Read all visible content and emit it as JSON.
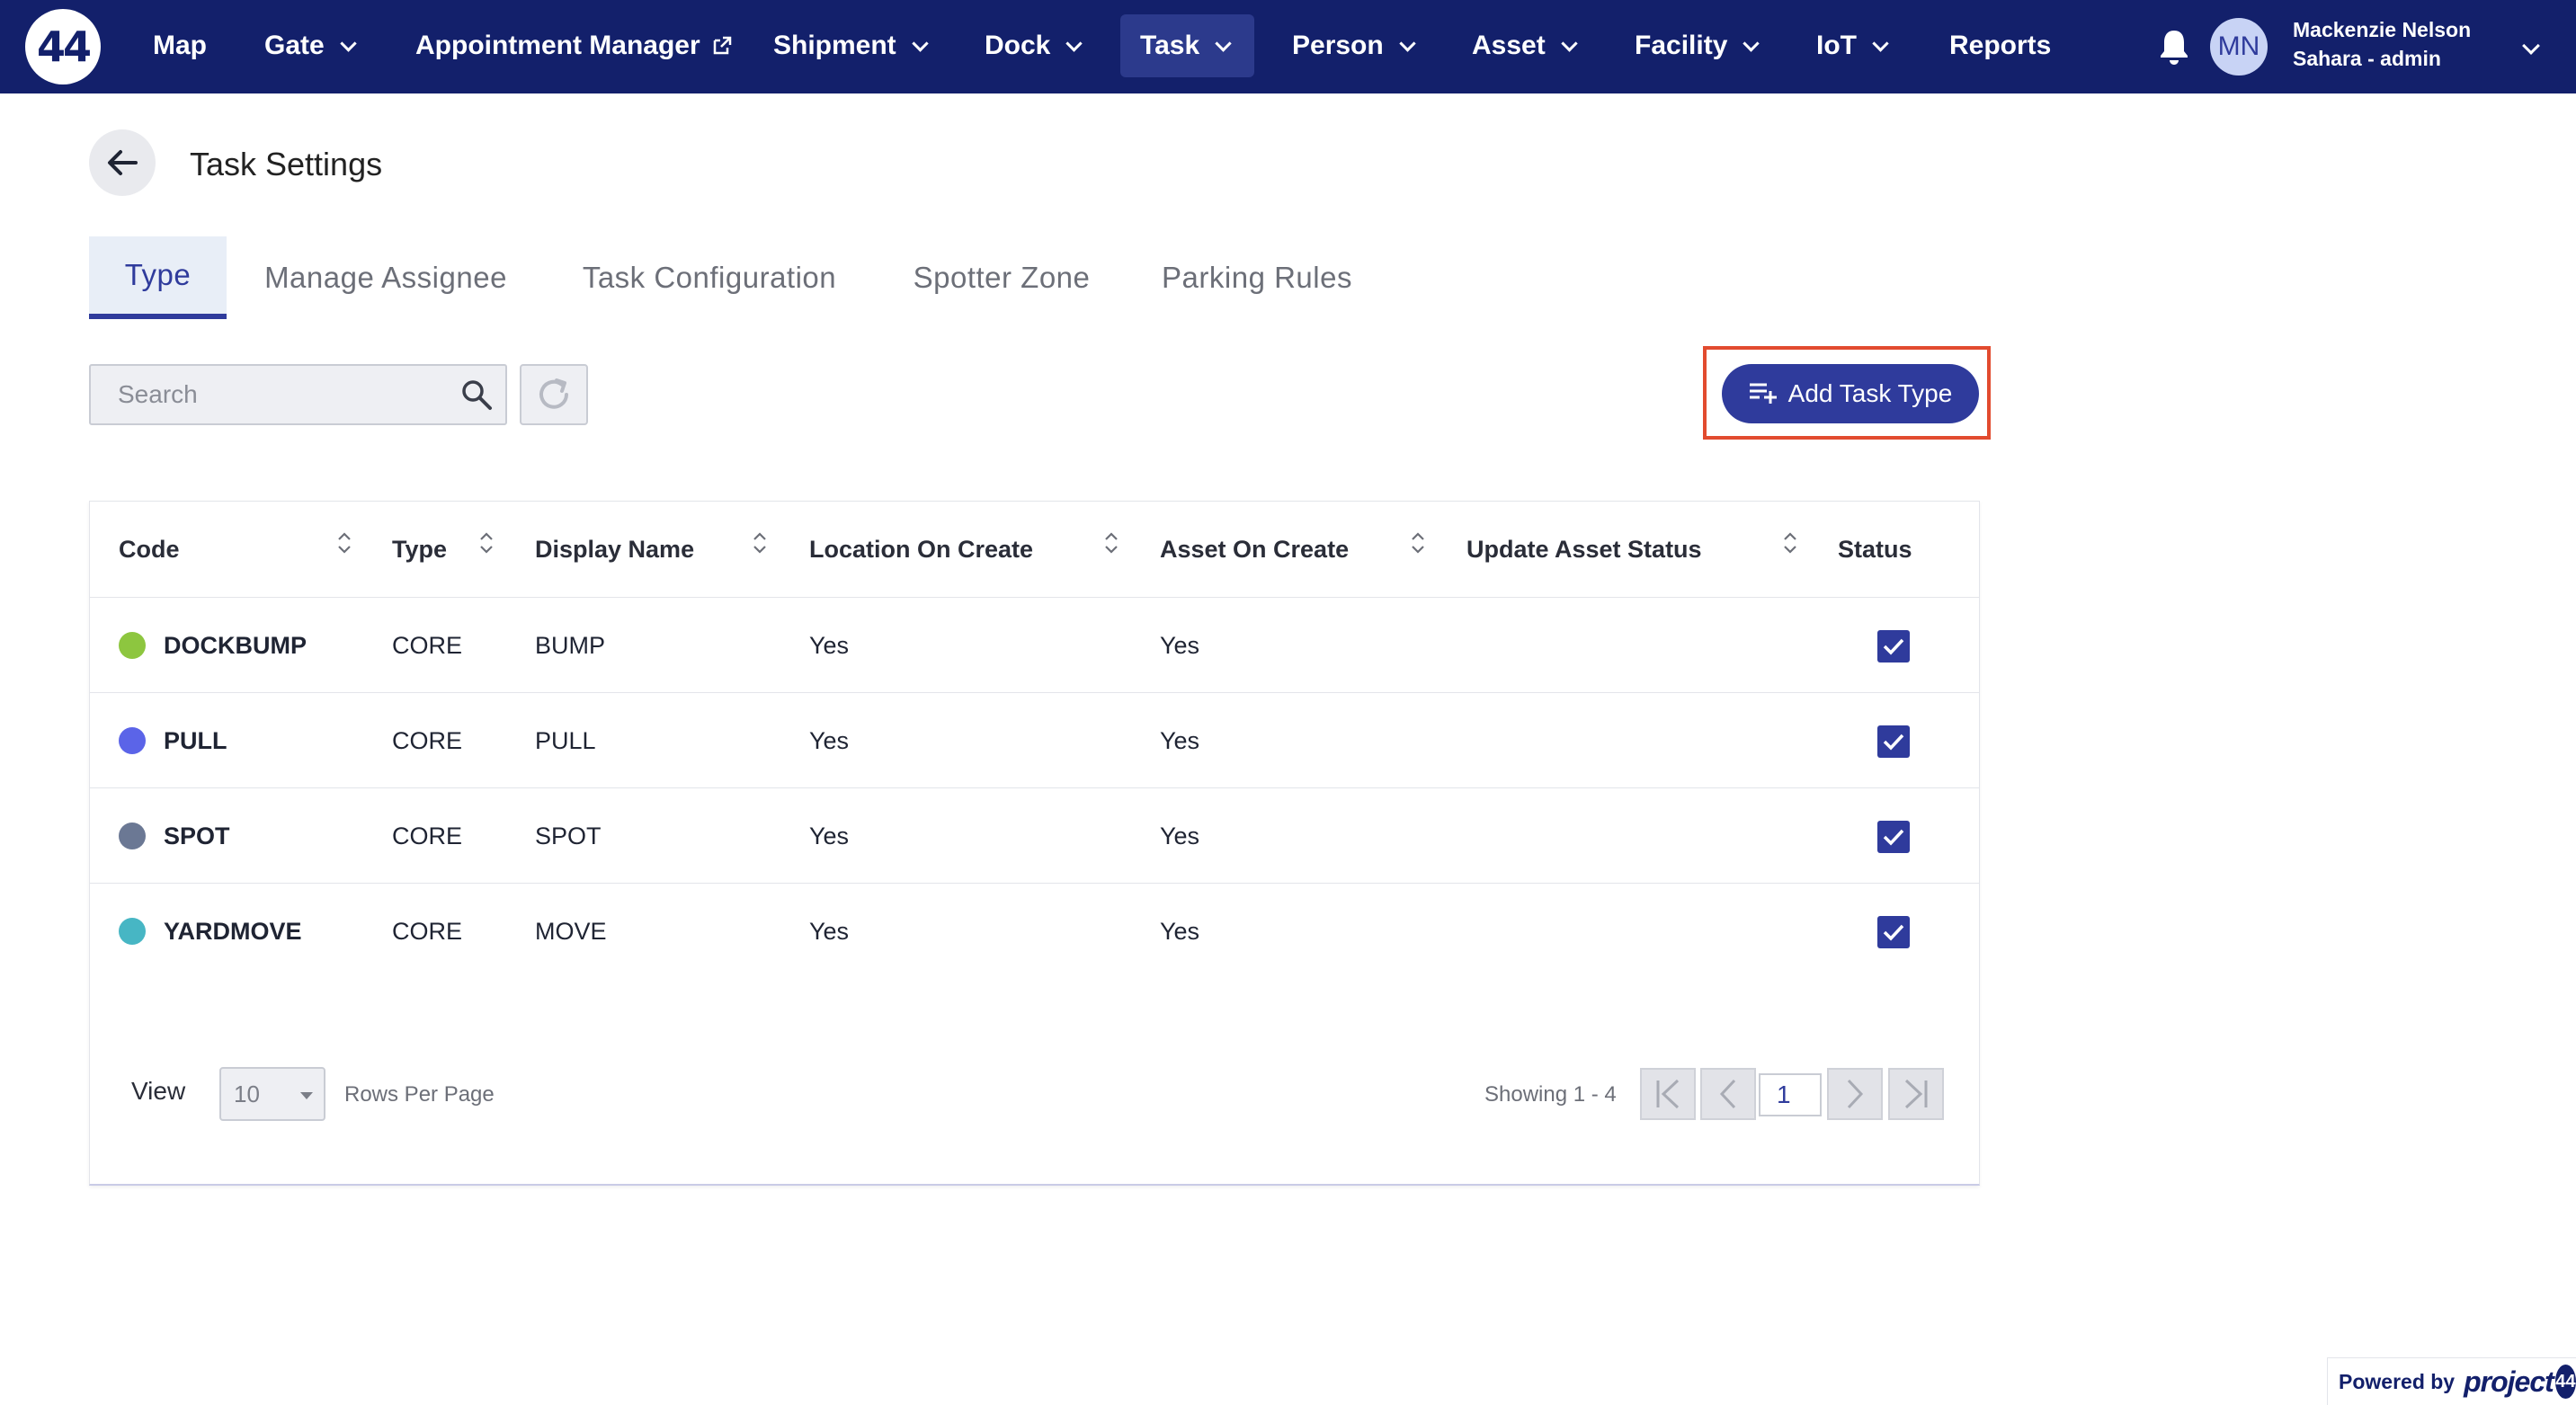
{
  "nav": {
    "logo": "44",
    "items": [
      {
        "label": "Map",
        "dropdown": false
      },
      {
        "label": "Gate",
        "dropdown": true
      },
      {
        "label": "Appointment Manager",
        "dropdown": false,
        "external": true
      },
      {
        "label": "Shipment",
        "dropdown": true
      },
      {
        "label": "Dock",
        "dropdown": true
      },
      {
        "label": "Task",
        "dropdown": true,
        "active": true
      },
      {
        "label": "Person",
        "dropdown": true
      },
      {
        "label": "Asset",
        "dropdown": true
      },
      {
        "label": "Facility",
        "dropdown": true
      },
      {
        "label": "IoT",
        "dropdown": true
      },
      {
        "label": "Reports",
        "dropdown": false
      }
    ],
    "user": {
      "initials": "MN",
      "name": "Mackenzie Nelson",
      "role": "Sahara - admin"
    }
  },
  "header": {
    "title": "Task Settings",
    "back_icon": "arrow-left-icon"
  },
  "tabs": [
    {
      "label": "Type",
      "active": true
    },
    {
      "label": "Manage Assignee"
    },
    {
      "label": "Task Configuration"
    },
    {
      "label": "Spotter Zone"
    },
    {
      "label": "Parking Rules"
    }
  ],
  "toolbar": {
    "search_placeholder": "Search",
    "search_value": "",
    "add_button_label": "Add Task Type"
  },
  "table": {
    "columns": [
      "Code",
      "Type",
      "Display Name",
      "Location On Create",
      "Asset On Create",
      "Update Asset Status",
      "Status"
    ],
    "rows": [
      {
        "color": "#8dc63f",
        "code": "DOCKBUMP",
        "type": "CORE",
        "display_name": "BUMP",
        "location_on_create": "Yes",
        "asset_on_create": "Yes",
        "update_asset_status": "",
        "status": true
      },
      {
        "color": "#5b64e8",
        "code": "PULL",
        "type": "CORE",
        "display_name": "PULL",
        "location_on_create": "Yes",
        "asset_on_create": "Yes",
        "update_asset_status": "",
        "status": true
      },
      {
        "color": "#6b7894",
        "code": "SPOT",
        "type": "CORE",
        "display_name": "SPOT",
        "location_on_create": "Yes",
        "asset_on_create": "Yes",
        "update_asset_status": "",
        "status": true
      },
      {
        "color": "#47b6c4",
        "code": "YARDMOVE",
        "type": "CORE",
        "display_name": "MOVE",
        "location_on_create": "Yes",
        "asset_on_create": "Yes",
        "update_asset_status": "",
        "status": true
      }
    ]
  },
  "pagination": {
    "view_label": "View",
    "rows_per_page": "10",
    "rows_per_page_label": "Rows Per Page",
    "showing": "Showing 1 - 4",
    "current_page": "1"
  },
  "footer": {
    "powered_by": "Powered by",
    "brand": "project",
    "brand_badge": "44"
  },
  "colors": {
    "navbar": "#13206b",
    "accent": "#2f3b9c",
    "highlight": "#e24b2f"
  }
}
